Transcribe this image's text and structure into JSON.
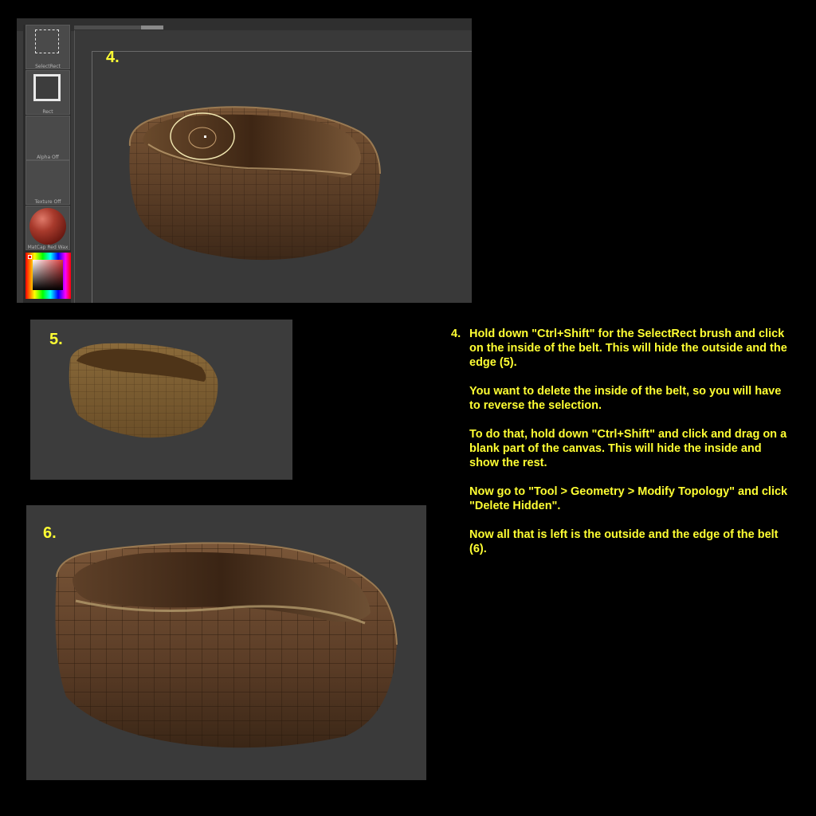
{
  "shelf": {
    "items": [
      {
        "label": "SelectRect",
        "icon": "select-rect-icon"
      },
      {
        "label": "Rect",
        "icon": "rect-icon"
      },
      {
        "label": "Alpha Off",
        "icon": "alpha-icon"
      },
      {
        "label": "Texture Off",
        "icon": "texture-icon"
      },
      {
        "label": "MatCap Red Wax",
        "icon": "material-sphere-icon"
      }
    ],
    "color_picker_icon": "color-picker-icon"
  },
  "steps": {
    "four": "4.",
    "five": "5.",
    "six": "6."
  },
  "instructions": {
    "number": "4.",
    "paragraphs": [
      "Hold down \"Ctrl+Shift\" for the SelectRect brush and click on the inside of the belt. This will hide the outside and the edge (5).",
      "You want to delete the inside of the belt, so you will have to reverse the selection.",
      "To do that, hold down \"Ctrl+Shift\" and click and drag on a blank part of the canvas. This will hide the inside and show the rest.",
      "Now go to \"Tool > Geometry > Modify Topology\" and click \"Delete Hidden\".",
      "",
      "Now all that is left is the outside and the edge of the belt (6)."
    ]
  },
  "colors": {
    "highlight": "#ffff33",
    "belt": "#6b4a2e",
    "canvas": "#3a3a3a"
  }
}
